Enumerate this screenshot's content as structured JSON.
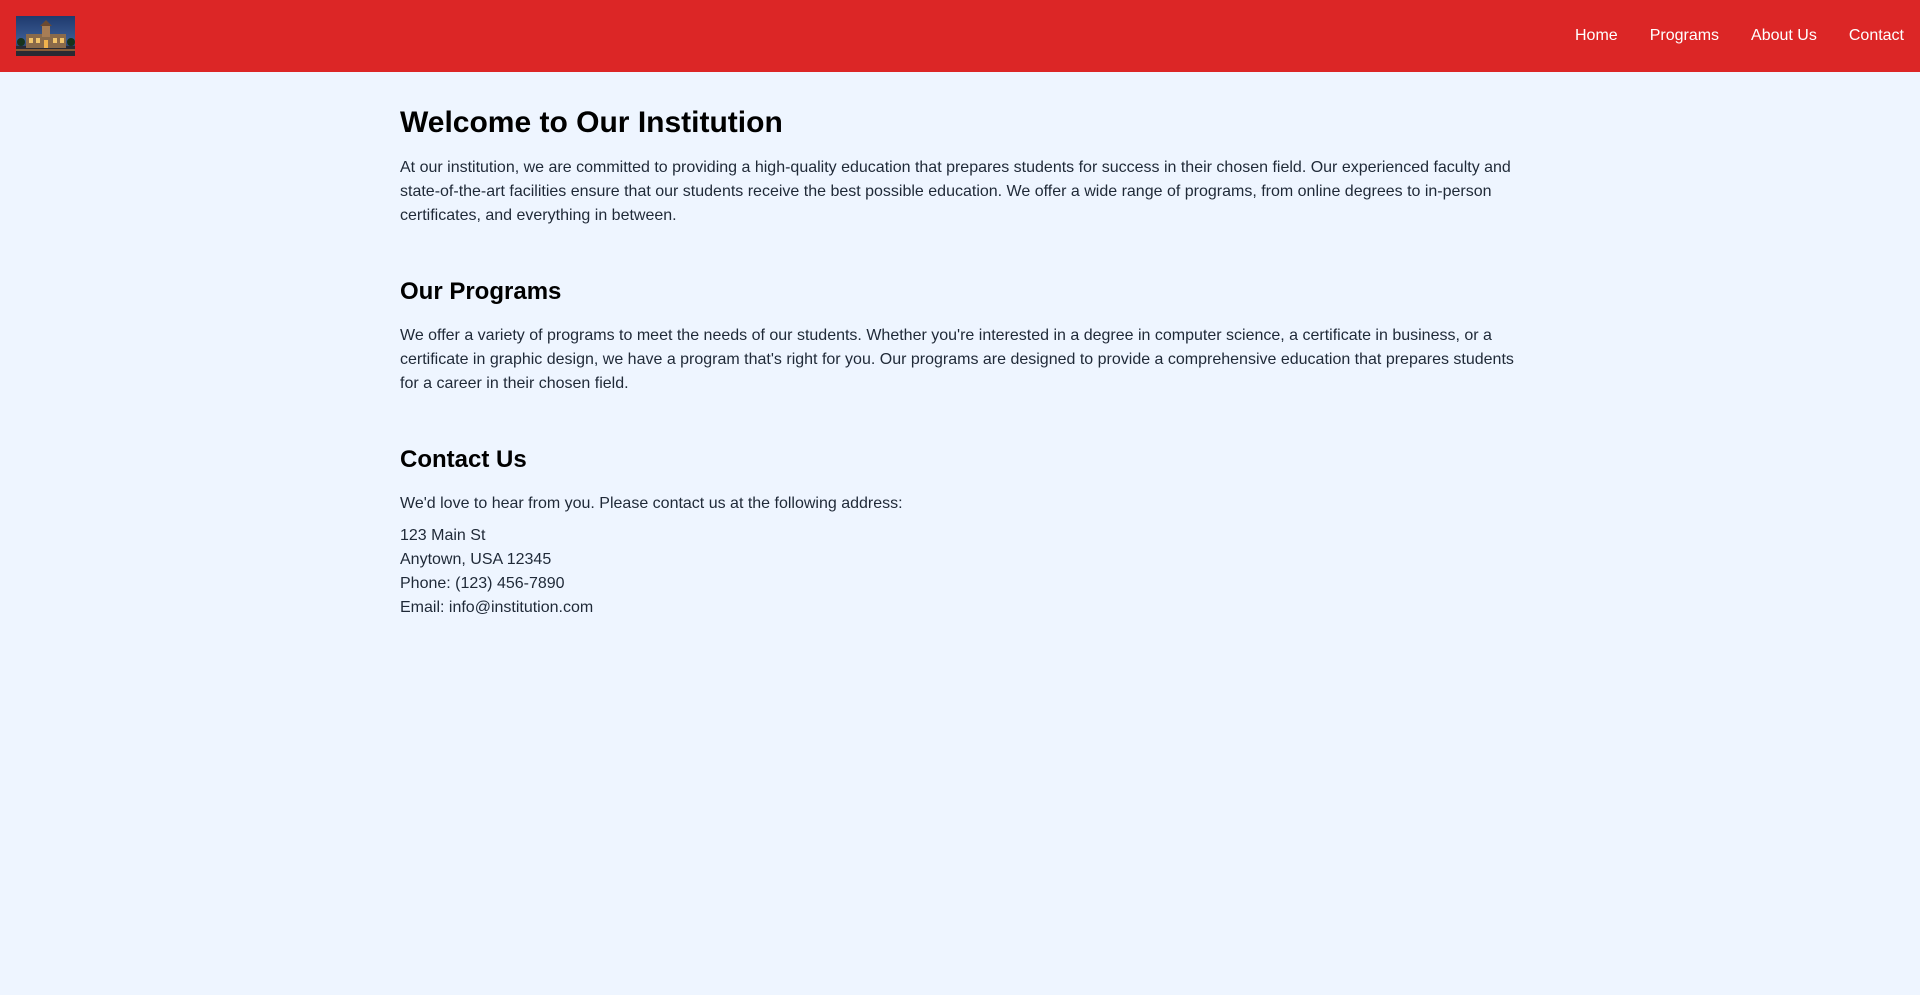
{
  "header": {
    "logo_alt": "Institution building at night",
    "nav": [
      {
        "label": "Home"
      },
      {
        "label": "Programs"
      },
      {
        "label": "About Us"
      },
      {
        "label": "Contact"
      }
    ],
    "colors": {
      "bar": "#dc2626",
      "text": "#ffffff"
    }
  },
  "main": {
    "welcome": {
      "title": "Welcome to Our Institution",
      "body": "At our institution, we are committed to providing a high-quality education that prepares students for success in their chosen field. Our experienced faculty and state-of-the-art facilities ensure that our students receive the best possible education. We offer a wide range of programs, from online degrees to in-person certificates, and everything in between."
    },
    "programs": {
      "title": "Our Programs",
      "body": "We offer a variety of programs to meet the needs of our students. Whether you're interested in a degree in computer science, a certificate in business, or a certificate in graphic design, we have a program that's right for you. Our programs are designed to provide a comprehensive education that prepares students for a career in their chosen field."
    },
    "contact": {
      "title": "Contact Us",
      "intro": "We'd love to hear from you. Please contact us at the following address:",
      "street": "123 Main St",
      "city": "Anytown, USA 12345",
      "phone": "Phone: (123) 456-7890",
      "email": "Email: info@institution.com"
    }
  },
  "colors": {
    "background": "#eef5ff",
    "heading": "#000000",
    "body_text": "#1f2937"
  }
}
